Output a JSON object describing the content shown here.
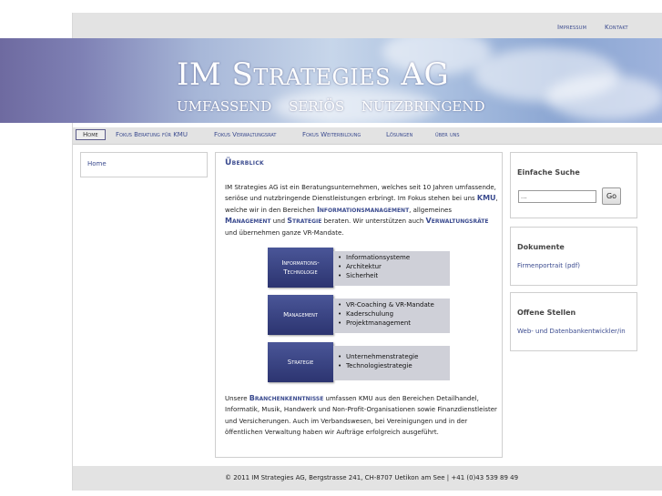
{
  "topnav": {
    "impressum": "Impressum",
    "kontakt": "Kontakt"
  },
  "banner": {
    "title": "IM Strategies AG",
    "tagline": "UMFASSEND  SERIÖS  NUTZBRINGEND"
  },
  "nav": {
    "items": [
      "Home",
      "Fokus Beratung für KMU",
      "Fokus Verwaltungsrat",
      "Fokus Weiterbildung",
      "Lösungen",
      "über uns"
    ]
  },
  "left": {
    "home": "Home"
  },
  "main": {
    "heading": "Überblick",
    "p1": {
      "t1": "IM Strategies AG ist ein Beratungsunternehmen, welches seit 10 Jahren umfassende, seriöse und nutzbringende Dienstleistungen erbringt. Im Fokus stehen bei uns ",
      "h1": "KMU",
      "t2": ", welche wir in den Bereichen ",
      "h2": "Informationsmanagement",
      "t3": ", allgemeines ",
      "h3": "Management",
      "t4": " und ",
      "h4": "Strategie",
      "t5": " beraten. Wir unterstützen auch ",
      "h5": "Verwaltungsräte",
      "t6": " und übernehmen ganze VR-Mandate."
    },
    "diagram": [
      {
        "label1": "Informations-",
        "label2": "Technologie",
        "items": [
          "Informationsysteme",
          "Architektur",
          "Sicherheit"
        ]
      },
      {
        "label1": "Management",
        "label2": "",
        "items": [
          "VR-Coaching & VR-Mandate",
          "Kaderschulung",
          "Projektmanagement"
        ]
      },
      {
        "label1": "Strategie",
        "label2": "",
        "items": [
          "Unternehmenstrategie",
          "Technologiestrategie"
        ]
      }
    ],
    "p2": {
      "t1": "Unsere ",
      "h1": "Branchenkenntnisse",
      "t2": " umfassen KMU aus den Bereichen Detailhandel, Informatik, Musik, Handwerk und Non-Profit-Organisationen sowie Finanzdienstleister und Versicherungen. Auch im Verbandswesen, bei Vereinigungen und in der öffentlichen Verwaltung haben wir Aufträge erfolgreich ausgeführt."
    }
  },
  "sidebar": {
    "search": {
      "title": "Einfache Suche",
      "value": "...",
      "button": "Go"
    },
    "docs": {
      "title": "Dokumente",
      "link": "Firmenportrait (pdf)"
    },
    "jobs": {
      "title": "Offene Stellen",
      "link": "Web- und Datenbankentwickler/in"
    }
  },
  "footer": {
    "text": "© 2011 IM Strategies AG, Bergstrasse 241, CH-8707 Uetikon am See | +41 (0)43 539 89 49"
  }
}
